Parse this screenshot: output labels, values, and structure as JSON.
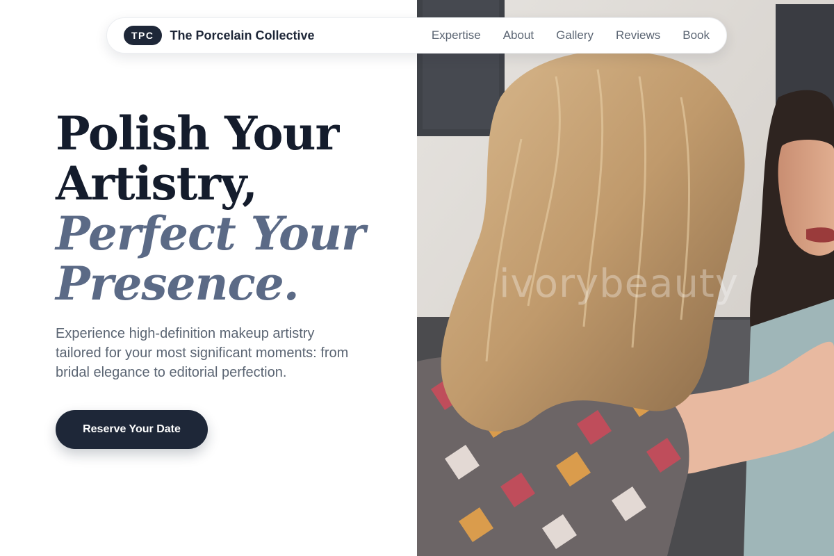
{
  "nav": {
    "logo_initials": "TPC",
    "brand_name": "The Porcelain Collective",
    "links": [
      "Expertise",
      "About",
      "Gallery",
      "Reviews",
      "Book"
    ]
  },
  "hero": {
    "headline_line1": "Polish Your",
    "headline_line2": "Artistry,",
    "headline_line3": "Perfect Your",
    "headline_line4": "Presence.",
    "subtext": "Experience high-definition makeup artistry tailored for your most significant moments: from bridal elegance to editorial perfection.",
    "cta_label": "Reserve Your Date"
  },
  "image": {
    "watermark": "ivorybeauty",
    "description_icon": "photo-makeup-artist-with-client"
  },
  "colors": {
    "primary": "#1e2738",
    "headline_dark": "#141c2c",
    "headline_accent": "#5b6a86",
    "body_text": "#5b6573",
    "background": "#ffffff"
  }
}
